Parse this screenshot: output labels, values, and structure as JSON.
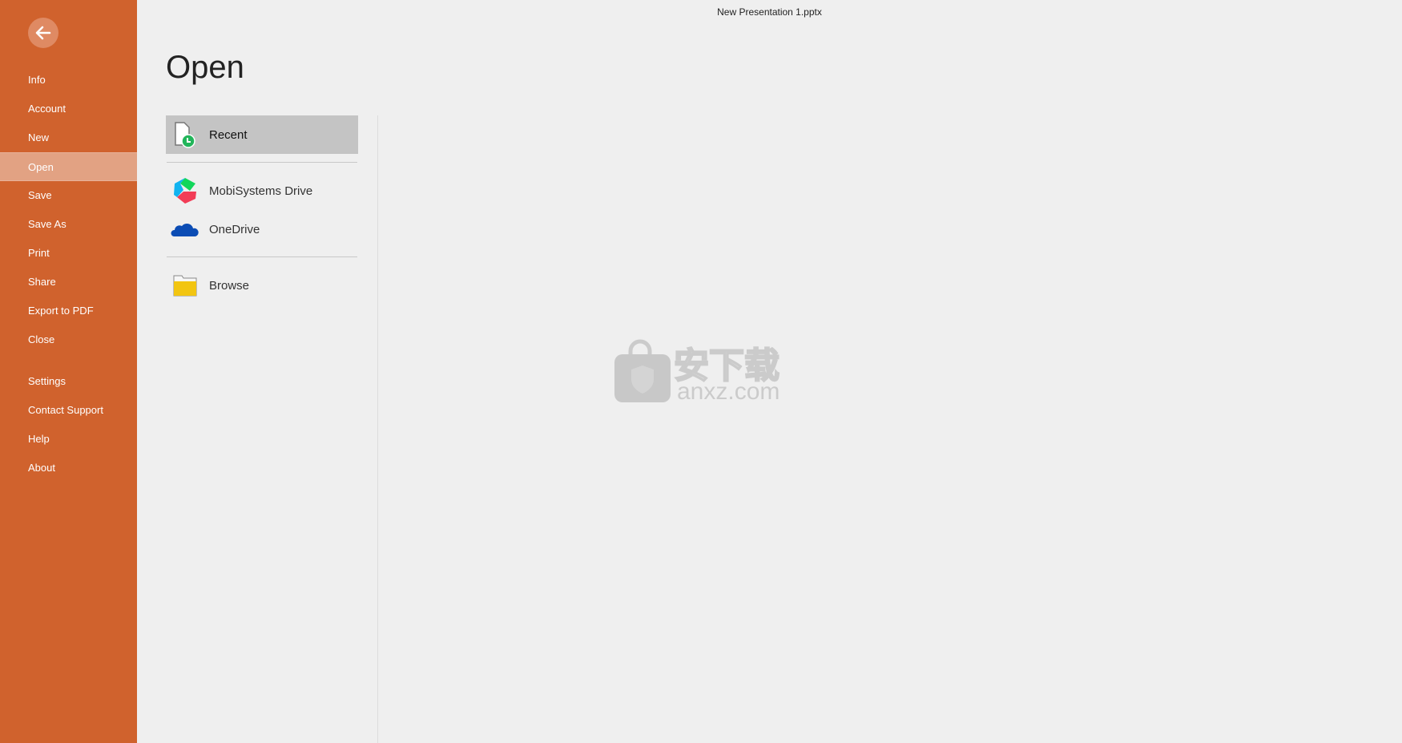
{
  "window": {
    "title": "New Presentation 1.pptx"
  },
  "sidebar": {
    "back_icon": "arrow-left-icon",
    "items": [
      {
        "label": "Info"
      },
      {
        "label": "Account"
      },
      {
        "label": "New"
      },
      {
        "label": "Open",
        "active": true
      },
      {
        "label": "Save"
      },
      {
        "label": "Save As"
      },
      {
        "label": "Print"
      },
      {
        "label": "Share"
      },
      {
        "label": "Export to PDF"
      },
      {
        "label": "Close"
      },
      {
        "label": "Settings"
      },
      {
        "label": "Contact Support"
      },
      {
        "label": "Help"
      },
      {
        "label": "About"
      }
    ]
  },
  "main": {
    "title": "Open",
    "locations": [
      {
        "label": "Recent",
        "icon": "recent-file-icon",
        "active": true
      },
      {
        "label": "MobiSystems Drive",
        "icon": "mobisystems-drive-icon"
      },
      {
        "label": "OneDrive",
        "icon": "onedrive-icon"
      },
      {
        "label": "Browse",
        "icon": "folder-icon"
      }
    ]
  },
  "watermark": {
    "text": "安下载",
    "subtext": "anxz.com"
  },
  "colors": {
    "sidebar": "#d0622d",
    "active_nav": "#e2a283",
    "selected_location": "#c4c4c4"
  }
}
